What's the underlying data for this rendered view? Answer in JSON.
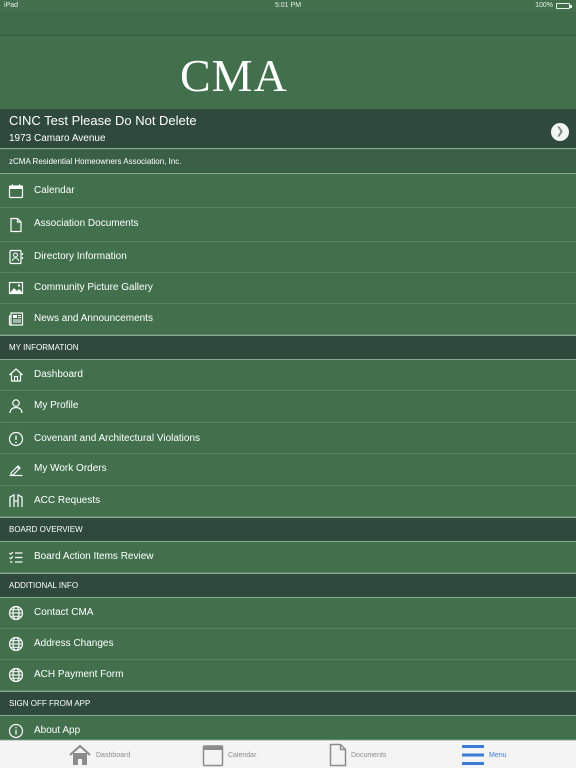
{
  "status_bar": {
    "device": "iPad",
    "time": "5:01 PM",
    "battery": "100%",
    "battery_level": 1.0
  },
  "logo": {
    "text": "CMA"
  },
  "association": {
    "title": "CINC Test Please Do Not Delete",
    "address": "1973 Camaro Avenue",
    "org_name": "zCMA Residential Homeowners Association, Inc."
  },
  "menu": {
    "association_items": [
      {
        "label": "Calendar",
        "icon": "calendar-icon"
      },
      {
        "label": "Association Documents",
        "icon": "document-icon"
      },
      {
        "label": "Directory Information",
        "icon": "contact-card-icon"
      },
      {
        "label": "Community Picture Gallery",
        "icon": "picture-icon"
      },
      {
        "label": "News and Announcements",
        "icon": "newspaper-icon"
      }
    ],
    "my_information": {
      "header": "MY INFORMATION",
      "items": [
        {
          "label": "Dashboard",
          "icon": "home-icon"
        },
        {
          "label": "My Profile",
          "icon": "person-icon"
        },
        {
          "label": "Covenant and Architectural Violations",
          "icon": "alert-icon"
        },
        {
          "label": "My Work Orders",
          "icon": "work-order-icon"
        },
        {
          "label": "ACC Requests",
          "icon": "acc-request-icon"
        }
      ]
    },
    "board_overview": {
      "header": "BOARD OVERVIEW",
      "items": [
        {
          "label": "Board Action Items Review",
          "icon": "checklist-icon"
        }
      ]
    },
    "additional_info": {
      "header": "ADDITIONAL INFO",
      "items": [
        {
          "label": "Contact CMA",
          "icon": "globe-icon"
        },
        {
          "label": "Address Changes",
          "icon": "globe-icon"
        },
        {
          "label": "ACH Payment Form",
          "icon": "globe-icon"
        }
      ]
    },
    "sign_off": {
      "header": "SIGN OFF FROM APP",
      "items": [
        {
          "label": "About App",
          "icon": "info-icon"
        }
      ]
    }
  },
  "tab_bar": {
    "tabs": [
      {
        "label": "Dashboard",
        "icon": "home-icon"
      },
      {
        "label": "Calendar",
        "icon": "calendar-icon"
      },
      {
        "label": "Documents",
        "icon": "document-icon"
      },
      {
        "label": "Menu",
        "icon": "menu-icon",
        "active": true
      }
    ]
  },
  "colors": {
    "background": "#42704d",
    "section_header": "#2f4a3c",
    "tab_active": "#3a7bd5"
  }
}
